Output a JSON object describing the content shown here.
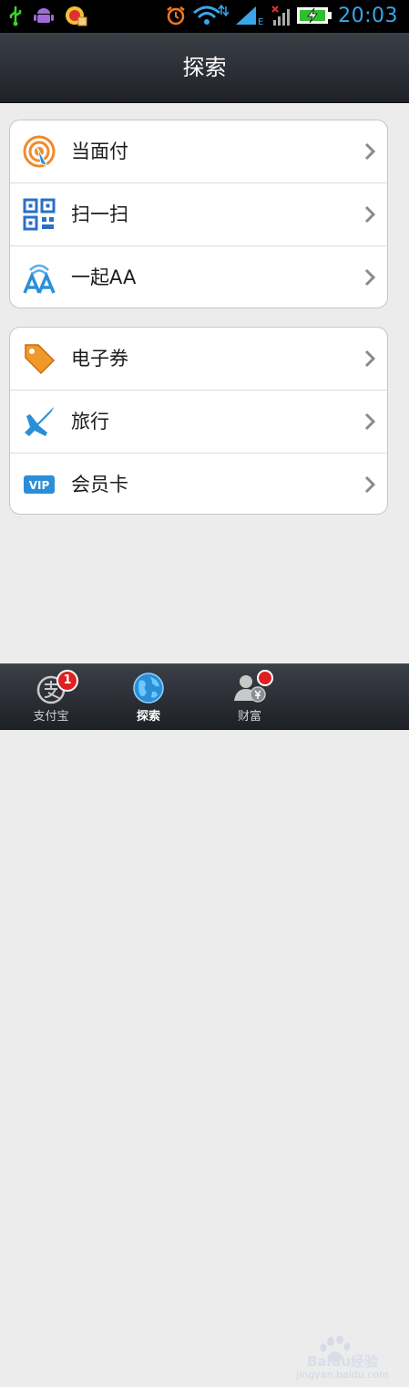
{
  "status_bar": {
    "time": "20:03",
    "icons": [
      "usb-icon",
      "android-icon",
      "app-icon",
      "alarm-icon",
      "wifi-icon",
      "signal-icon",
      "signal-off-icon",
      "battery-charging-icon"
    ],
    "network_letter": "E"
  },
  "header": {
    "title": "探索"
  },
  "groups": [
    {
      "items": [
        {
          "label": "当面付",
          "icon": "face-pay-icon"
        },
        {
          "label": "扫一扫",
          "icon": "qr-scan-icon"
        },
        {
          "label": "一起AA",
          "icon": "split-aa-icon"
        }
      ]
    },
    {
      "items": [
        {
          "label": "电子券",
          "icon": "coupon-tag-icon"
        },
        {
          "label": "旅行",
          "icon": "airplane-icon"
        },
        {
          "label": "会员卡",
          "icon": "vip-card-icon",
          "icon_text": "VIP"
        }
      ]
    }
  ],
  "tab_bar": {
    "tabs": [
      {
        "label": "支付宝",
        "icon": "alipay-icon",
        "badge": "1"
      },
      {
        "label": "探索",
        "icon": "globe-icon",
        "active": true
      },
      {
        "label": "财富",
        "icon": "wealth-user-icon"
      }
    ]
  },
  "watermark": {
    "brand": "Baidu经验",
    "url": "jingyan.baidu.com"
  },
  "colors": {
    "accent_time": "#3aa6e8",
    "badge": "#e02020",
    "icon_blue": "#2a8fd8",
    "icon_orange": "#f08a2a"
  }
}
